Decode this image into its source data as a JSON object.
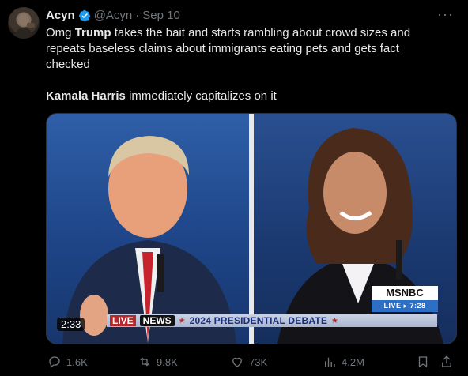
{
  "tweet": {
    "author_name": "Acyn",
    "handle": "@Acyn",
    "separator": "·",
    "date": "Sep 10",
    "more_label": "···",
    "text_line1_prefix": "Omg ",
    "text_line1_bold": "Trump",
    "text_line1_rest": " takes the bait and starts rambling about crowd sizes and repeats baseless claims about immigrants eating pets and gets fact checked",
    "text_line2_bold": "Kamala Harris",
    "text_line2_rest": " immediately capitalizes on it"
  },
  "media": {
    "duration": "2:33",
    "lower_third": {
      "live": "LIVE",
      "network": "NEWS",
      "title": "2024 PRESIDENTIAL DEBATE"
    },
    "msnbc": {
      "logo_text": "MSNBC",
      "live_label": "LIVE ▸ 7:28"
    }
  },
  "actions": {
    "replies": "1.6K",
    "reposts": "9.8K",
    "likes": "73K",
    "views": "4.2M"
  },
  "colors": {
    "background": "#000000",
    "text": "#e7e9ea",
    "muted": "#71767b",
    "verified_blue": "#1d9bf0"
  }
}
